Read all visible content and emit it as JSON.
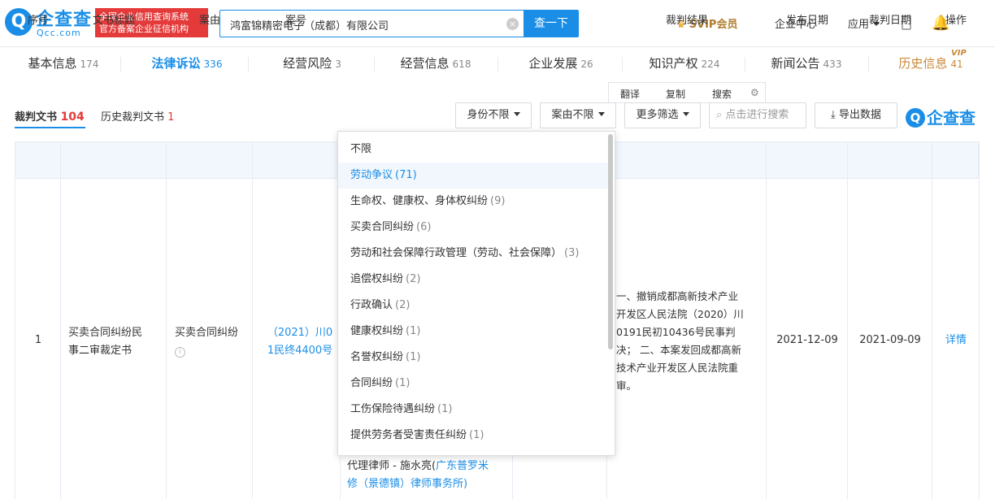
{
  "header": {
    "logo_mark": "Q",
    "logo_text": "企查查",
    "logo_sub": "Qcc.com",
    "official_line1": "全国企业信用查询系统",
    "official_line2": "官方备案企业征信机构",
    "search_value": "鸿富锦精密电子（成都）有限公司",
    "search_button": "查一下",
    "svip": "SVIP会员",
    "enterprise_center": "企业中心",
    "apps": "应用"
  },
  "tabs": [
    {
      "label": "基本信息",
      "count": "174"
    },
    {
      "label": "法律诉讼",
      "count": "336"
    },
    {
      "label": "经营风险",
      "count": "3"
    },
    {
      "label": "经营信息",
      "count": "618"
    },
    {
      "label": "企业发展",
      "count": "26"
    },
    {
      "label": "知识产权",
      "count": "224"
    },
    {
      "label": "新闻公告",
      "count": "433"
    },
    {
      "label": "历史信息",
      "count": "41",
      "badge": "VIP"
    }
  ],
  "mini_tools": {
    "translate": "翻译",
    "copy": "复制",
    "search": "搜索"
  },
  "subtabs": {
    "judgment_label": "裁判文书",
    "judgment_count": "104",
    "history_label": "历史裁判文书",
    "history_count": "1"
  },
  "filters": {
    "identity": "身份不限",
    "cause": "案由不限",
    "more": "更多筛选",
    "search_placeholder": "点击进行搜索",
    "export": "导出数据",
    "brand": "企查查"
  },
  "table": {
    "headers": [
      "序号",
      "文书标题",
      "案由",
      "案号",
      "裁判结果",
      "发布日期",
      "裁判日期",
      "操作"
    ],
    "row": {
      "index": "1",
      "title_line1": "买卖合同纠纷民",
      "title_line2": "事二审裁定书",
      "cause": "买卖合同纠纷",
      "case_no_line1": "（2021）川0",
      "case_no_line2": "1民终4400号",
      "result_lines": [
        "一、撤销成都高新技术产业",
        "开发区人民法院（2020）川",
        "0191民初10436号民事判",
        "决；  二、本案发回成都高新",
        "技术产业开发区人民法院重",
        "审。"
      ],
      "publish_date": "2021-12-09",
      "judge_date": "2021-09-09",
      "action": "详情",
      "lawyer_prefix": "代理律师 - 施水亮(",
      "lawyer_firm_line1": "广东普罗米",
      "lawyer_firm_line2": "修（景德镇）律师事务所)"
    }
  },
  "dropdown": {
    "items": [
      {
        "label": "不限",
        "count": ""
      },
      {
        "label": "劳动争议",
        "count": "(71)"
      },
      {
        "label": "生命权、健康权、身体权纠纷",
        "count": "(9)"
      },
      {
        "label": "买卖合同纠纷",
        "count": "(6)"
      },
      {
        "label": "劳动和社会保障行政管理（劳动、社会保障）",
        "count": "(3)"
      },
      {
        "label": "追偿权纠纷",
        "count": "(2)"
      },
      {
        "label": "行政确认",
        "count": "(2)"
      },
      {
        "label": "健康权纠纷",
        "count": "(1)"
      },
      {
        "label": "名誉权纠纷",
        "count": "(1)"
      },
      {
        "label": "合同纠纷",
        "count": "(1)"
      },
      {
        "label": "工伤保险待遇纠纷",
        "count": "(1)"
      },
      {
        "label": "提供劳务者受害责任纠纷",
        "count": "(1)"
      }
    ]
  }
}
